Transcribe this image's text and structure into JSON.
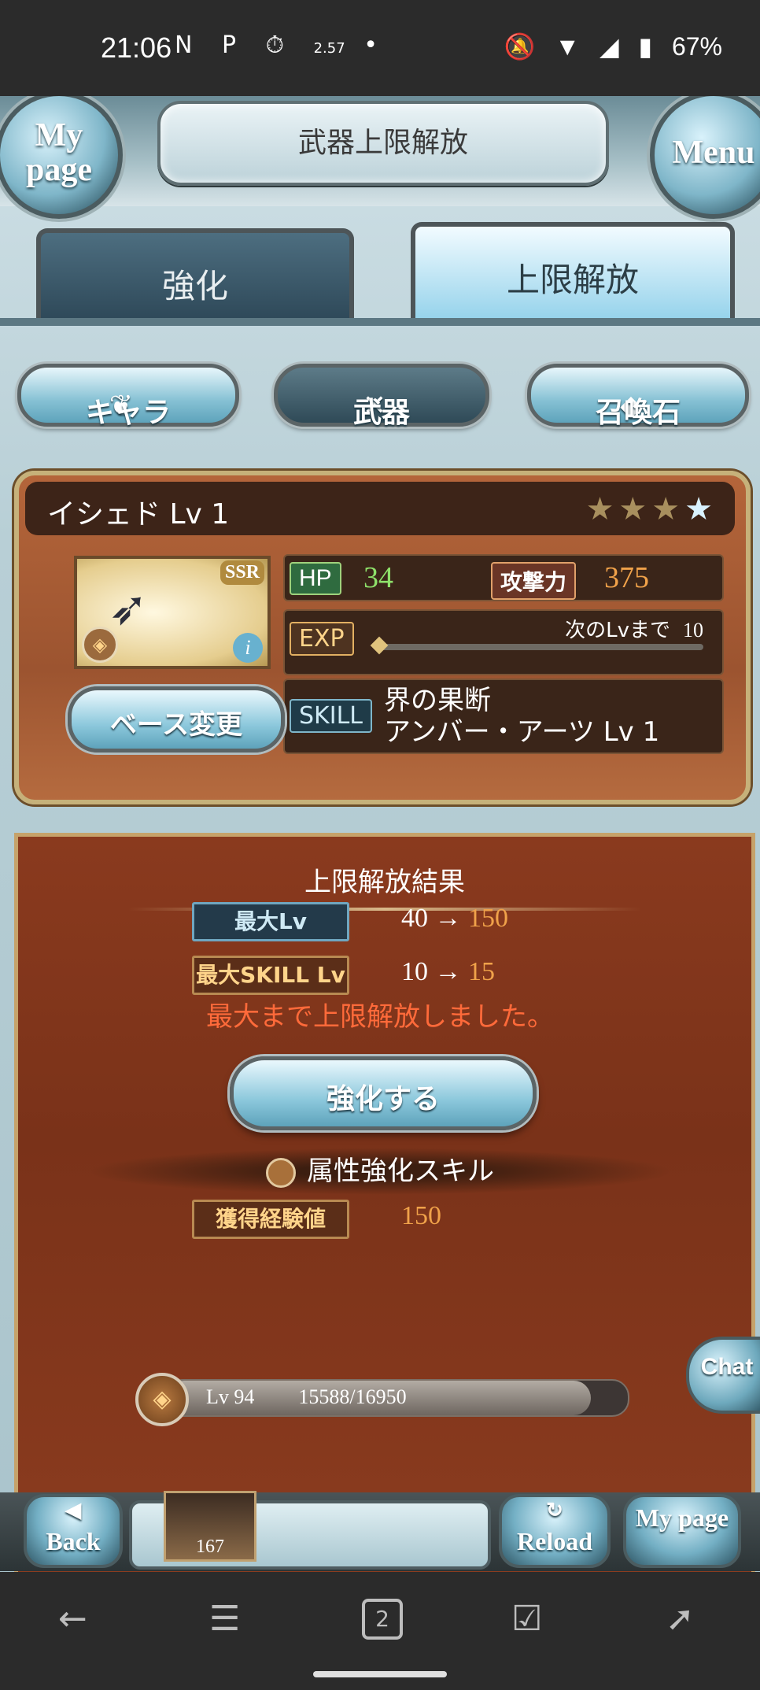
{
  "status_bar": {
    "time": "21:06",
    "left_icons": [
      "N",
      "P",
      "⏱",
      "2.57",
      "•"
    ],
    "battery": "67%"
  },
  "header": {
    "title": "武器上限解放",
    "mypage_label": "My page",
    "menu_label": "Menu"
  },
  "tabs": [
    {
      "label": "強化",
      "active": false
    },
    {
      "label": "上限解放",
      "active": true
    }
  ],
  "categories": [
    {
      "label": "キャラ",
      "icon": "wing-icon"
    },
    {
      "label": "武器",
      "icon": "crossed-swords-icon"
    },
    {
      "label": "召喚石",
      "icon": "crystal-icon"
    }
  ],
  "weapon": {
    "name": "イシェド Lv 1",
    "rarity": "SSR",
    "uncap_stars": 4,
    "uncap_filled": 3,
    "hp_label": "HP",
    "hp_value": "34",
    "atk_label": "攻撃力",
    "atk_value": "375",
    "exp_label": "EXP",
    "next_lv_label": "次のLvまで",
    "next_lv_value": "10",
    "exp_progress": 0,
    "skill_label": "SKILL",
    "skill_line1": "界の果断",
    "skill_line2": "アンバー・アーツ Lv 1",
    "base_change_label": "ベース変更"
  },
  "result": {
    "title": "上限解放結果",
    "max_lv_label": "最大Lv",
    "max_lv_from": "40",
    "max_lv_to": "150",
    "max_skill_label": "最大SKILL Lv",
    "max_skill_from": "10",
    "max_skill_to": "15",
    "message": "最大まで上限解放しました。",
    "enhance_button": "強化する",
    "attr_skill_label": "属性強化スキル",
    "exp_gained_label": "獲得経験値",
    "exp_gained_value": "150",
    "lv_label": "Lv 94",
    "lv_progress_text": "15588/16950",
    "lv_progress": 0.92
  },
  "chat_label": "Chat",
  "bottom_bar": {
    "back_label": "Back",
    "reload_label": "Reload",
    "mypage_label": "My page",
    "ticket_count": "167"
  },
  "nav": {
    "tab_count": "2"
  },
  "colors": {
    "accent_blue": "#8cc8dc",
    "panel_brown": "#9c5430",
    "result_red": "#7a3219",
    "message_red": "#ff6a3a",
    "value_orange": "#f0a24a",
    "hp_green": "#8ee06a"
  }
}
